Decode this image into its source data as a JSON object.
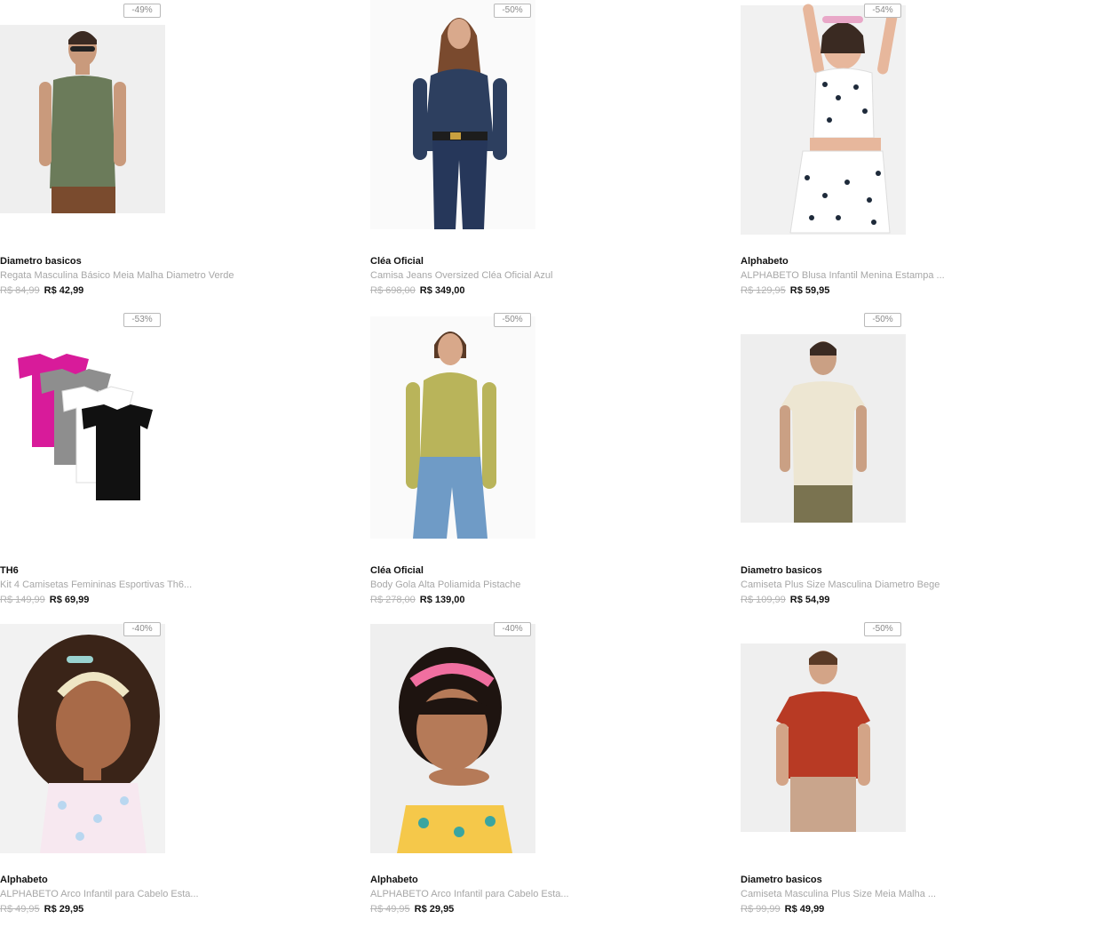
{
  "products": [
    {
      "discount": "-49%",
      "brand": "Diametro basicos",
      "name": "Regata Masculina Básico Meia Malha Diametro Verde",
      "old_price": "R$ 84,99",
      "price": "R$ 42,99"
    },
    {
      "discount": "-50%",
      "brand": "Cléa Oficial",
      "name": "Camisa Jeans Oversized Cléa Oficial Azul",
      "old_price": "R$ 698,00",
      "price": "R$ 349,00"
    },
    {
      "discount": "-54%",
      "brand": "Alphabeto",
      "name": "ALPHABETO Blusa Infantil Menina Estampa ...",
      "old_price": "R$ 129,95",
      "price": "R$ 59,95"
    },
    {
      "discount": "-53%",
      "brand": "TH6",
      "name": "Kit 4 Camisetas Femininas Esportivas Th6...",
      "old_price": "R$ 149,99",
      "price": "R$ 69,99"
    },
    {
      "discount": "-50%",
      "brand": "Cléa Oficial",
      "name": "Body Gola Alta Poliamida Pistache",
      "old_price": "R$ 278,00",
      "price": "R$ 139,00"
    },
    {
      "discount": "-50%",
      "brand": "Diametro basicos",
      "name": "Camiseta Plus Size Masculina Diametro Bege",
      "old_price": "R$ 109,99",
      "price": "R$ 54,99"
    },
    {
      "discount": "-40%",
      "brand": "Alphabeto",
      "name": "ALPHABETO Arco Infantil para Cabelo Esta...",
      "old_price": "R$ 49,95",
      "price": "R$ 29,95"
    },
    {
      "discount": "-40%",
      "brand": "Alphabeto",
      "name": "ALPHABETO Arco Infantil para Cabelo Esta...",
      "old_price": "R$ 49,95",
      "price": "R$ 29,95"
    },
    {
      "discount": "-50%",
      "brand": "Diametro basicos",
      "name": "Camiseta Masculina Plus Size Meia Malha ...",
      "old_price": "R$ 99,99",
      "price": "R$ 49,99"
    }
  ]
}
